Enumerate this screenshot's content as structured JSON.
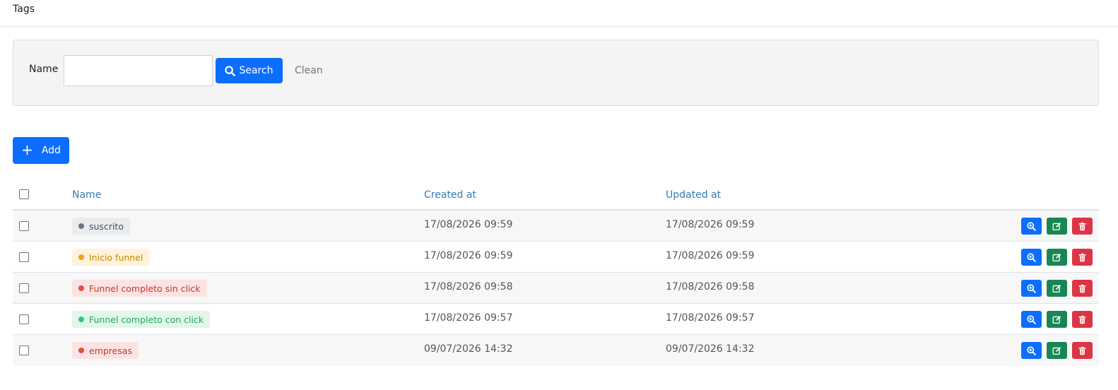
{
  "header": {
    "title": "Tags"
  },
  "filter": {
    "name_label": "Name",
    "name_value": "",
    "search_label": "Search",
    "clean_label": "Clean"
  },
  "toolbar": {
    "add_label": "Add"
  },
  "table": {
    "columns": [
      "Name",
      "Created at",
      "Updated at"
    ],
    "rows": [
      {
        "name": "suscrito",
        "created": "17/08/2026 09:59",
        "updated": "17/08/2026 09:59",
        "tag_bg": "#e9ecef",
        "tag_fg": "#495057",
        "dot": "#6c757d"
      },
      {
        "name": "Inicio funnel",
        "created": "17/08/2026 09:59",
        "updated": "17/08/2026 09:59",
        "tag_bg": "#fff3d9",
        "tag_fg": "#c98a00",
        "dot": "#f0a020"
      },
      {
        "name": "Funnel completo sin click",
        "created": "17/08/2026 09:58",
        "updated": "17/08/2026 09:58",
        "tag_bg": "#fce3e3",
        "tag_fg": "#c0392b",
        "dot": "#e74c3c"
      },
      {
        "name": "Funnel completo con click",
        "created": "17/08/2026 09:57",
        "updated": "17/08/2026 09:57",
        "tag_bg": "#e0f7e9",
        "tag_fg": "#27a55a",
        "dot": "#2ecc71"
      },
      {
        "name": "empresas",
        "created": "09/07/2026 14:32",
        "updated": "09/07/2026 14:32",
        "tag_bg": "#fce3e3",
        "tag_fg": "#c0392b",
        "dot": "#e74c3c"
      }
    ]
  },
  "colors": {
    "primary": "#0d6efd",
    "success": "#198754",
    "danger": "#dc3545",
    "link": "#337ab7"
  },
  "icons": {
    "search": "search-icon",
    "add": "plus-icon",
    "view": "zoom-in-icon",
    "edit": "edit-icon",
    "delete": "trash-icon"
  }
}
